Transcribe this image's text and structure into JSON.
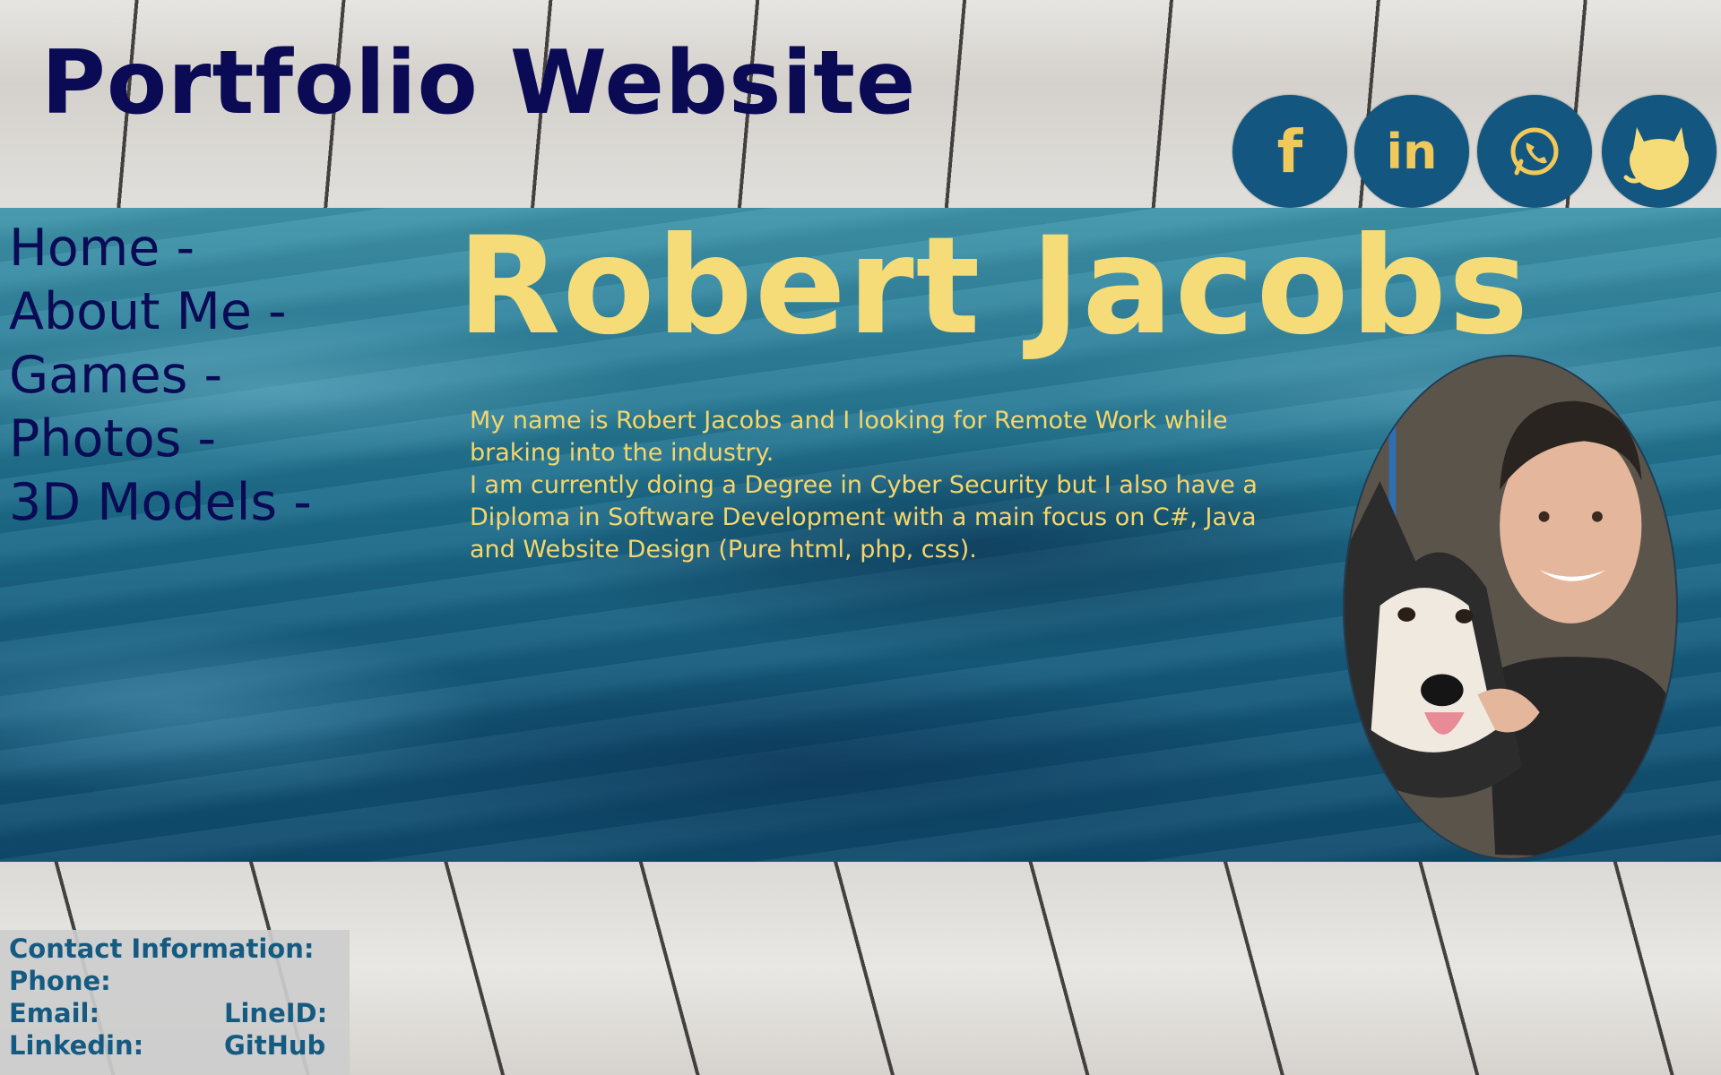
{
  "header": {
    "title": "Portfolio Website"
  },
  "socials": [
    {
      "name": "Facebook",
      "icon": "facebook-icon",
      "glyph": "f"
    },
    {
      "name": "LinkedIn",
      "icon": "linkedin-icon",
      "glyph": "in"
    },
    {
      "name": "WhatsApp",
      "icon": "whatsapp-icon",
      "glyph": "✆"
    },
    {
      "name": "GitHub",
      "icon": "github-icon",
      "glyph": ""
    }
  ],
  "nav": {
    "items": [
      {
        "label": "Home -"
      },
      {
        "label": "About Me -"
      },
      {
        "label": "Games -"
      },
      {
        "label": "Photos -"
      },
      {
        "label": "3D Models -"
      }
    ]
  },
  "hero": {
    "name": "Robert Jacobs",
    "bio_line1": "My name is Robert Jacobs and I looking for Remote Work while braking into the industry.",
    "bio_line2": "I am currently doing a Degree in Cyber Security but I also have a Diploma in Software Development with a main focus on C#, Java and Website Design (Pure html, php, css)."
  },
  "contact": {
    "heading": "Contact Information:",
    "phone_label": "Phone:",
    "email_label": "Email:",
    "lineid_label": "LineID:",
    "linkedin_label": "Linkedin:",
    "github_label": "GitHub"
  },
  "colors": {
    "title": "#0b0a55",
    "accent_yellow": "#f5dc78",
    "social_bg": "#135680",
    "contact_text": "#155a80"
  }
}
